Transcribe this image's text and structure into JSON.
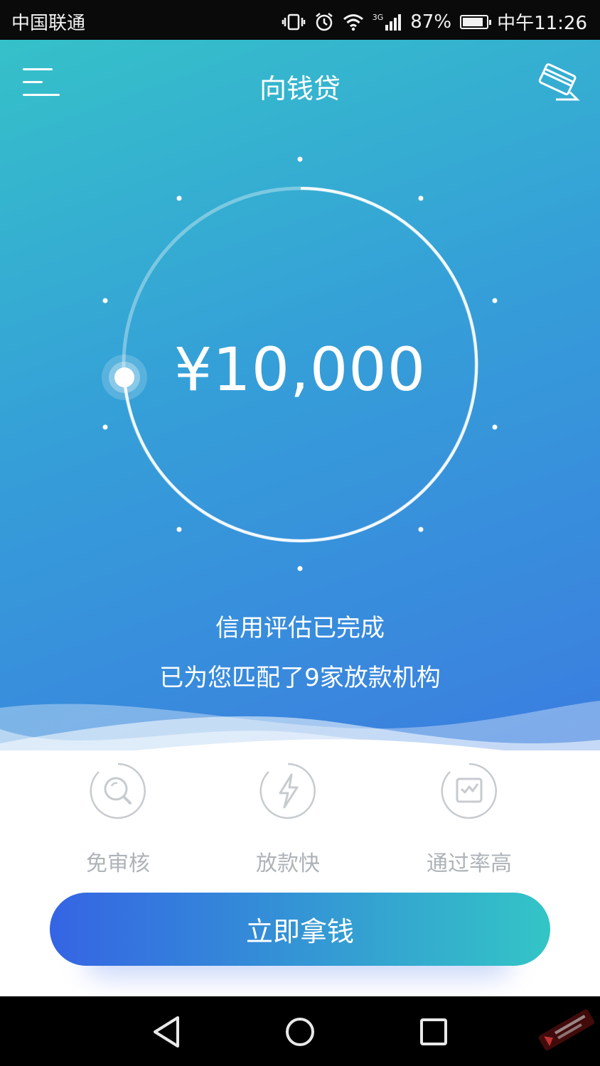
{
  "status_bar": {
    "carrier": "中国联通",
    "network": "3G",
    "battery": "87%",
    "battery_level": 0.87,
    "time": "中午11:26"
  },
  "header": {
    "title": "向钱贷",
    "menu_icon": "menu-icon",
    "card_icon": "credit-card-icon"
  },
  "loan": {
    "amount": "¥10,000"
  },
  "assessment": {
    "status": "信用评估已完成",
    "matched": "已为您匹配了9家放款机构"
  },
  "features": [
    {
      "label": "免审核",
      "icon": "magnifier-icon"
    },
    {
      "label": "放款快",
      "icon": "lightning-icon"
    },
    {
      "label": "通过率高",
      "icon": "chart-check-icon"
    }
  ],
  "cta": {
    "label": "立即拿钱"
  },
  "nav": {
    "back_icon": "back-icon",
    "home_icon": "home-icon",
    "recents_icon": "recents-icon"
  },
  "colors": {
    "gradient_start": "#35c1c9",
    "gradient_end": "#3b7de0",
    "button_start": "#3564e4",
    "button_end": "#33c5c6",
    "feature_gray": "#aeb3b8"
  }
}
